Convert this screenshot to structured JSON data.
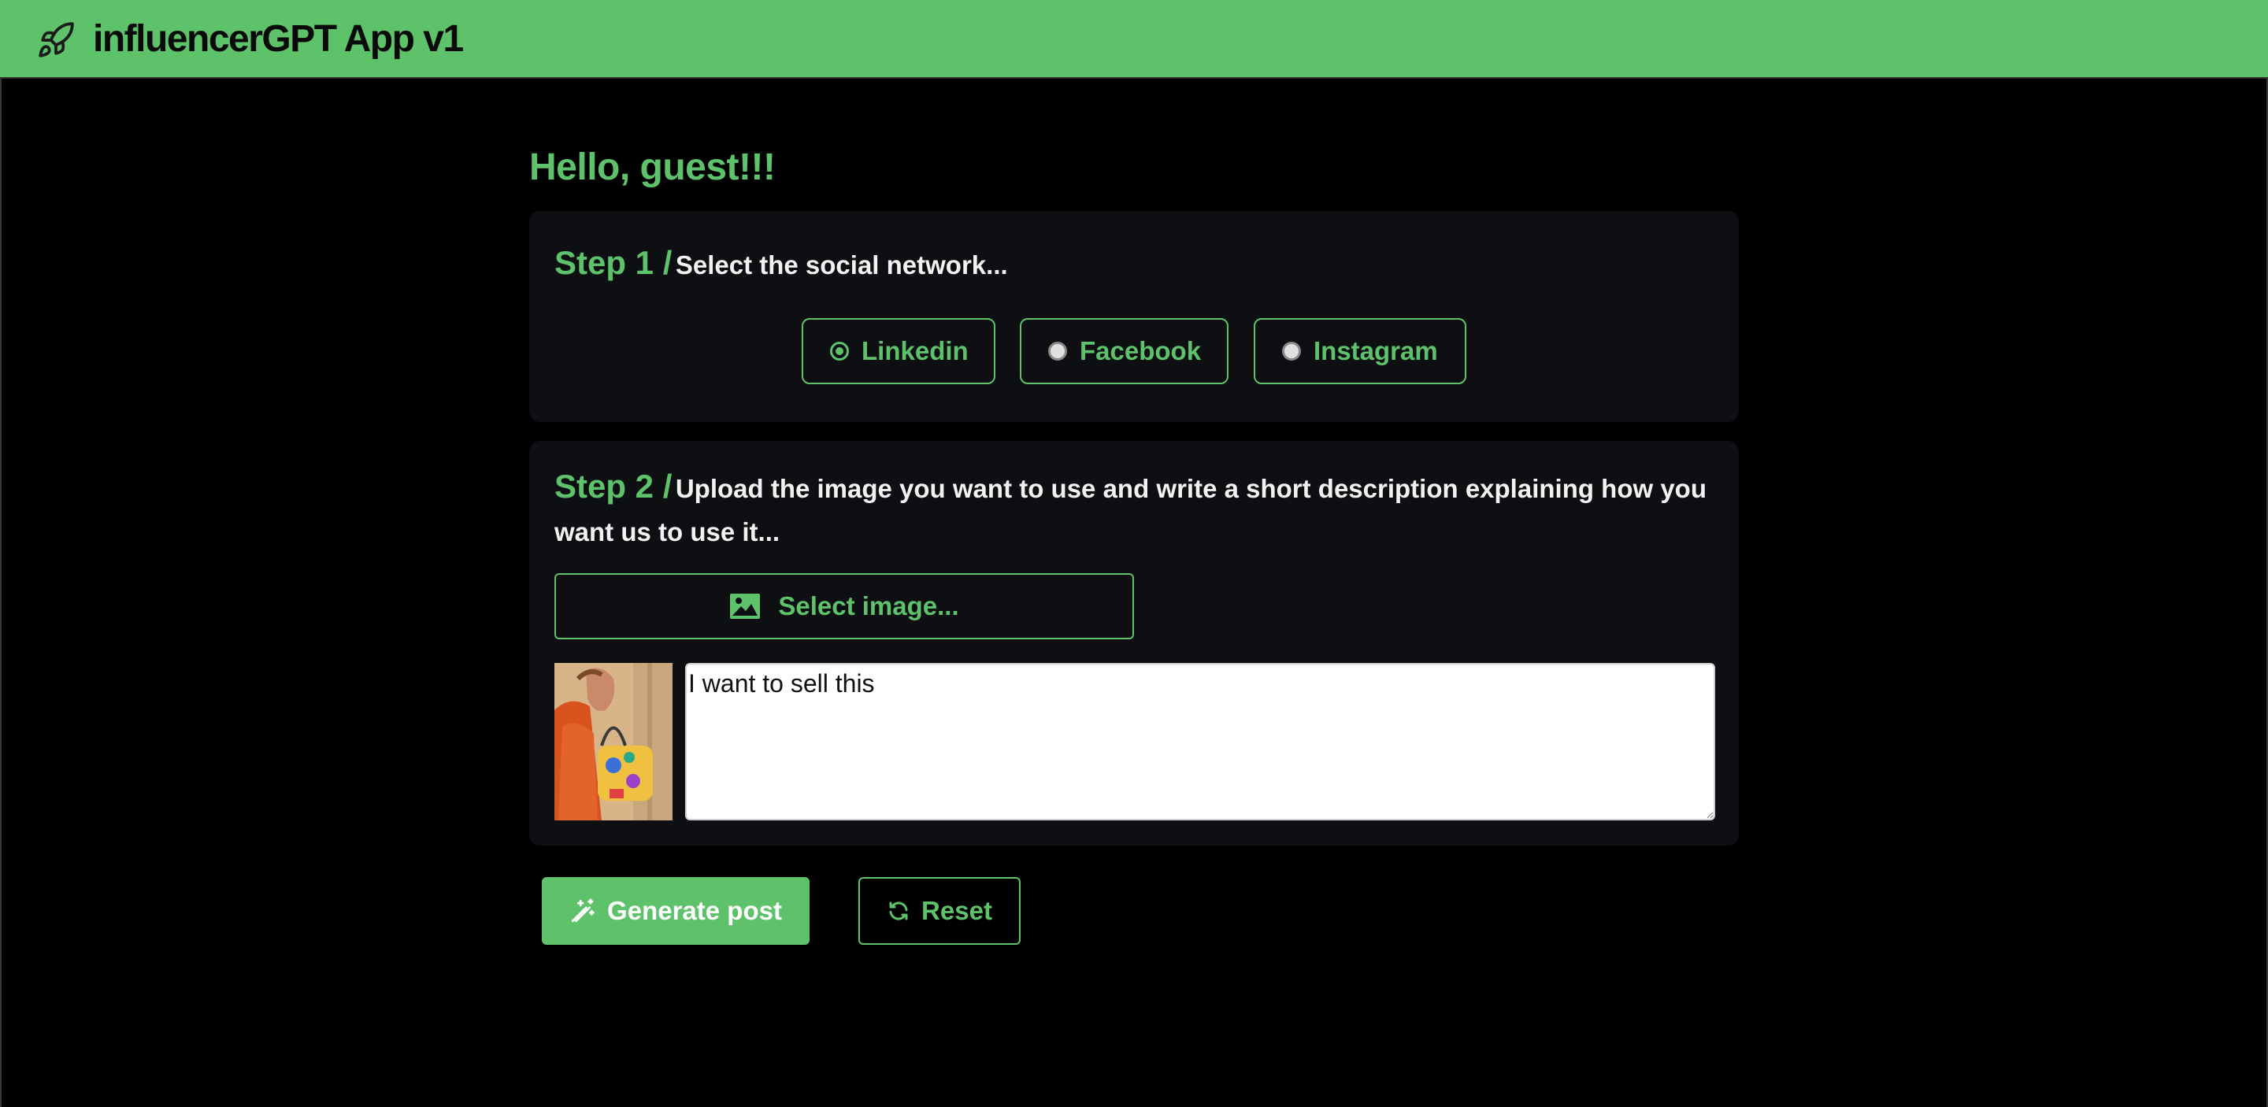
{
  "header": {
    "app_title": "influencerGPT App v1",
    "logo_icon": "rocket-icon",
    "background_color": "#5dc26a"
  },
  "greeting": "Hello, guest!!!",
  "step1": {
    "number": "Step 1 /",
    "instruction": "Select the social network...",
    "options": [
      {
        "label": "Linkedin",
        "selected": true
      },
      {
        "label": "Facebook",
        "selected": false
      },
      {
        "label": "Instagram",
        "selected": false
      }
    ]
  },
  "step2": {
    "number": "Step 2 /",
    "instruction": "Upload the image you want to use and write a short description explaining how you want us to use it...",
    "select_image_label": "Select image...",
    "select_image_icon": "image-icon",
    "description_value": "I want to sell this"
  },
  "actions": {
    "generate_label": "Generate post",
    "generate_icon": "magic-wand-icon",
    "reset_label": "Reset",
    "reset_icon": "refresh-icon"
  },
  "theme": {
    "accent": "#5dc26a",
    "background": "#000000",
    "card": "#0e0f12"
  }
}
